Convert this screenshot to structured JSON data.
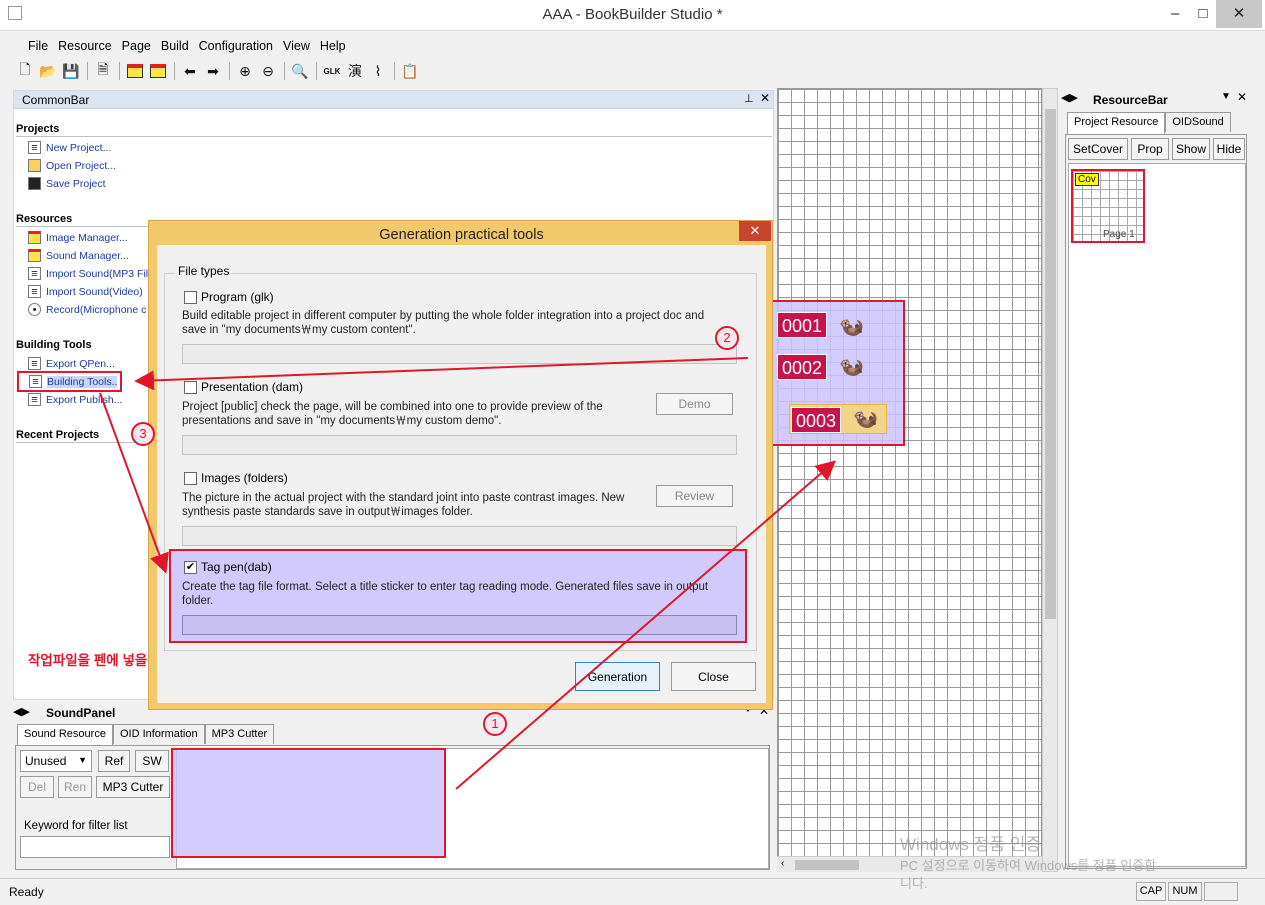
{
  "window": {
    "title": "AAA - BookBuilder Studio *",
    "min": "–",
    "max": "□",
    "close": "✕"
  },
  "menu": [
    "File",
    "Resource",
    "Page",
    "Build",
    "Configuration",
    "View",
    "Help"
  ],
  "toolbar_icons": [
    "new-icon",
    "open-icon",
    "save-icon",
    "properties-icon",
    "cover-icon",
    "cover2-icon",
    "back-icon",
    "forward-icon",
    "zoom-in-icon",
    "zoom-out-icon",
    "find-icon",
    "glk-icon",
    "script-icon",
    "chart-icon",
    "clipboard-icon"
  ],
  "commonbar": {
    "title": "CommonBar",
    "sections": {
      "projects": {
        "title": "Projects",
        "items": [
          "New Project...",
          "Open Project...",
          "Save Project"
        ]
      },
      "resources": {
        "title": "Resources",
        "items": [
          "Image Manager...",
          "Sound Manager...",
          "Import Sound(MP3 Fil",
          "Import Sound(Video)",
          "Record(Microphone c"
        ]
      },
      "building": {
        "title": "Building Tools",
        "items": [
          "Export QPen...",
          "Building Tools..",
          "Export Publish..."
        ]
      },
      "recent": {
        "title": "Recent Projects"
      }
    },
    "korean_note": "작업파일을 펜에 넣을수 있는 한개의 파일로 통합 및 dab 파일로 변환"
  },
  "dialog": {
    "title": "Generation practical tools",
    "group": "File types",
    "options": [
      {
        "label": "Program (glk)",
        "checked": false,
        "desc": "Build editable project in different computer by putting the whole folder integration into a project doc and save in \"my documents￦my custom content\".",
        "button": ""
      },
      {
        "label": "Presentation (dam)",
        "checked": false,
        "desc": "Project [public] check the page, will be combined into one to provide preview of the presentations and save in \"my documents￦my custom demo\".",
        "button": "Demo"
      },
      {
        "label": "Images (folders)",
        "checked": false,
        "desc": "The picture in the actual project with the standard joint into paste contrast images. New synthesis paste standards save in output￦images folder.",
        "button": "Review"
      },
      {
        "label": "Tag pen(dab)",
        "checked": true,
        "desc": "Create the tag file format. Select a title sticker to enter tag reading mode. Generated files save in output folder.",
        "button": ""
      }
    ],
    "generation": "Generation",
    "close": "Close"
  },
  "canvas": {
    "tags": [
      "0001",
      "0002",
      "0003"
    ]
  },
  "resourcebar": {
    "title": "ResourceBar",
    "tabs": [
      "Project Resource",
      "OIDSound"
    ],
    "buttons": [
      "SetCover",
      "Prop",
      "Show",
      "Hide"
    ],
    "thumb_badge": "Cov",
    "thumb_label": "Page 1"
  },
  "soundpanel": {
    "title": "SoundPanel",
    "tabs": [
      "Sound Resource",
      "OID Information",
      "MP3 Cutter"
    ],
    "select_value": "Unused",
    "buttons": [
      "Ref",
      "SW",
      "Del",
      "Ren",
      "MP3 Cutter"
    ],
    "filter_label": "Keyword for filter list"
  },
  "annotations": [
    "1",
    "2",
    "3"
  ],
  "watermark": {
    "line1": "Windows 정품 인증",
    "line2": "PC 설정으로 이동하여 Windows를 정품 인증합",
    "line3": "니다."
  },
  "status": {
    "text": "Ready",
    "cap": "CAP",
    "num": "NUM"
  }
}
